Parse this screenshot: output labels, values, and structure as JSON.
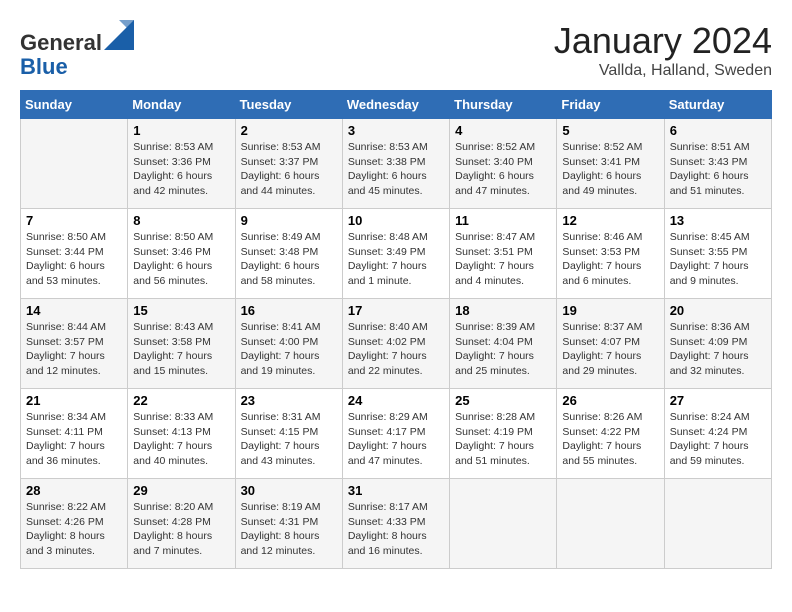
{
  "header": {
    "logo_general": "General",
    "logo_blue": "Blue",
    "month_title": "January 2024",
    "location": "Vallda, Halland, Sweden"
  },
  "days_of_week": [
    "Sunday",
    "Monday",
    "Tuesday",
    "Wednesday",
    "Thursday",
    "Friday",
    "Saturday"
  ],
  "weeks": [
    [
      {
        "day": "",
        "info": ""
      },
      {
        "day": "1",
        "info": "Sunrise: 8:53 AM\nSunset: 3:36 PM\nDaylight: 6 hours\nand 42 minutes."
      },
      {
        "day": "2",
        "info": "Sunrise: 8:53 AM\nSunset: 3:37 PM\nDaylight: 6 hours\nand 44 minutes."
      },
      {
        "day": "3",
        "info": "Sunrise: 8:53 AM\nSunset: 3:38 PM\nDaylight: 6 hours\nand 45 minutes."
      },
      {
        "day": "4",
        "info": "Sunrise: 8:52 AM\nSunset: 3:40 PM\nDaylight: 6 hours\nand 47 minutes."
      },
      {
        "day": "5",
        "info": "Sunrise: 8:52 AM\nSunset: 3:41 PM\nDaylight: 6 hours\nand 49 minutes."
      },
      {
        "day": "6",
        "info": "Sunrise: 8:51 AM\nSunset: 3:43 PM\nDaylight: 6 hours\nand 51 minutes."
      }
    ],
    [
      {
        "day": "7",
        "info": "Sunrise: 8:50 AM\nSunset: 3:44 PM\nDaylight: 6 hours\nand 53 minutes."
      },
      {
        "day": "8",
        "info": "Sunrise: 8:50 AM\nSunset: 3:46 PM\nDaylight: 6 hours\nand 56 minutes."
      },
      {
        "day": "9",
        "info": "Sunrise: 8:49 AM\nSunset: 3:48 PM\nDaylight: 6 hours\nand 58 minutes."
      },
      {
        "day": "10",
        "info": "Sunrise: 8:48 AM\nSunset: 3:49 PM\nDaylight: 7 hours\nand 1 minute."
      },
      {
        "day": "11",
        "info": "Sunrise: 8:47 AM\nSunset: 3:51 PM\nDaylight: 7 hours\nand 4 minutes."
      },
      {
        "day": "12",
        "info": "Sunrise: 8:46 AM\nSunset: 3:53 PM\nDaylight: 7 hours\nand 6 minutes."
      },
      {
        "day": "13",
        "info": "Sunrise: 8:45 AM\nSunset: 3:55 PM\nDaylight: 7 hours\nand 9 minutes."
      }
    ],
    [
      {
        "day": "14",
        "info": "Sunrise: 8:44 AM\nSunset: 3:57 PM\nDaylight: 7 hours\nand 12 minutes."
      },
      {
        "day": "15",
        "info": "Sunrise: 8:43 AM\nSunset: 3:58 PM\nDaylight: 7 hours\nand 15 minutes."
      },
      {
        "day": "16",
        "info": "Sunrise: 8:41 AM\nSunset: 4:00 PM\nDaylight: 7 hours\nand 19 minutes."
      },
      {
        "day": "17",
        "info": "Sunrise: 8:40 AM\nSunset: 4:02 PM\nDaylight: 7 hours\nand 22 minutes."
      },
      {
        "day": "18",
        "info": "Sunrise: 8:39 AM\nSunset: 4:04 PM\nDaylight: 7 hours\nand 25 minutes."
      },
      {
        "day": "19",
        "info": "Sunrise: 8:37 AM\nSunset: 4:07 PM\nDaylight: 7 hours\nand 29 minutes."
      },
      {
        "day": "20",
        "info": "Sunrise: 8:36 AM\nSunset: 4:09 PM\nDaylight: 7 hours\nand 32 minutes."
      }
    ],
    [
      {
        "day": "21",
        "info": "Sunrise: 8:34 AM\nSunset: 4:11 PM\nDaylight: 7 hours\nand 36 minutes."
      },
      {
        "day": "22",
        "info": "Sunrise: 8:33 AM\nSunset: 4:13 PM\nDaylight: 7 hours\nand 40 minutes."
      },
      {
        "day": "23",
        "info": "Sunrise: 8:31 AM\nSunset: 4:15 PM\nDaylight: 7 hours\nand 43 minutes."
      },
      {
        "day": "24",
        "info": "Sunrise: 8:29 AM\nSunset: 4:17 PM\nDaylight: 7 hours\nand 47 minutes."
      },
      {
        "day": "25",
        "info": "Sunrise: 8:28 AM\nSunset: 4:19 PM\nDaylight: 7 hours\nand 51 minutes."
      },
      {
        "day": "26",
        "info": "Sunrise: 8:26 AM\nSunset: 4:22 PM\nDaylight: 7 hours\nand 55 minutes."
      },
      {
        "day": "27",
        "info": "Sunrise: 8:24 AM\nSunset: 4:24 PM\nDaylight: 7 hours\nand 59 minutes."
      }
    ],
    [
      {
        "day": "28",
        "info": "Sunrise: 8:22 AM\nSunset: 4:26 PM\nDaylight: 8 hours\nand 3 minutes."
      },
      {
        "day": "29",
        "info": "Sunrise: 8:20 AM\nSunset: 4:28 PM\nDaylight: 8 hours\nand 7 minutes."
      },
      {
        "day": "30",
        "info": "Sunrise: 8:19 AM\nSunset: 4:31 PM\nDaylight: 8 hours\nand 12 minutes."
      },
      {
        "day": "31",
        "info": "Sunrise: 8:17 AM\nSunset: 4:33 PM\nDaylight: 8 hours\nand 16 minutes."
      },
      {
        "day": "",
        "info": ""
      },
      {
        "day": "",
        "info": ""
      },
      {
        "day": "",
        "info": ""
      }
    ]
  ]
}
